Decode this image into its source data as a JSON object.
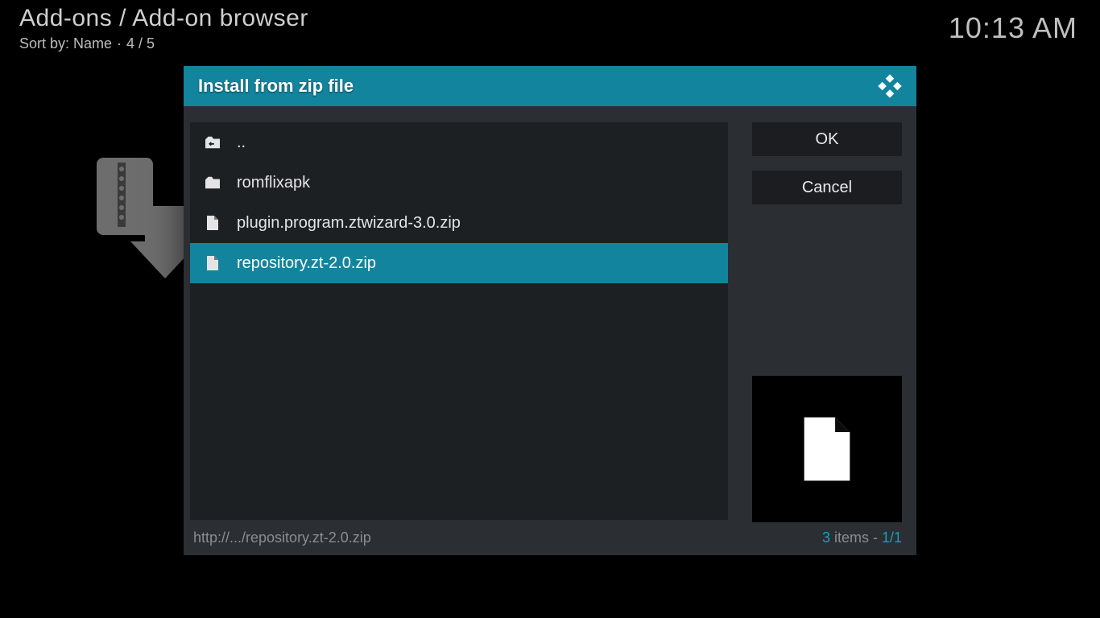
{
  "header": {
    "breadcrumb": "Add-ons / Add-on browser",
    "sort_label": "Sort by: Name",
    "position": "4 / 5",
    "clock": "10:13 AM"
  },
  "dialog": {
    "title": "Install from zip file",
    "items": [
      {
        "type": "up",
        "label": "..",
        "selected": false
      },
      {
        "type": "folder",
        "label": "romflixapk",
        "selected": false
      },
      {
        "type": "file",
        "label": "plugin.program.ztwizard-3.0.zip",
        "selected": false
      },
      {
        "type": "file",
        "label": "repository.zt-2.0.zip",
        "selected": true
      }
    ],
    "ok_label": "OK",
    "cancel_label": "Cancel",
    "path": "http://.../repository.zt-2.0.zip",
    "count_num": "3",
    "count_text": " items - ",
    "page": "1/1"
  }
}
